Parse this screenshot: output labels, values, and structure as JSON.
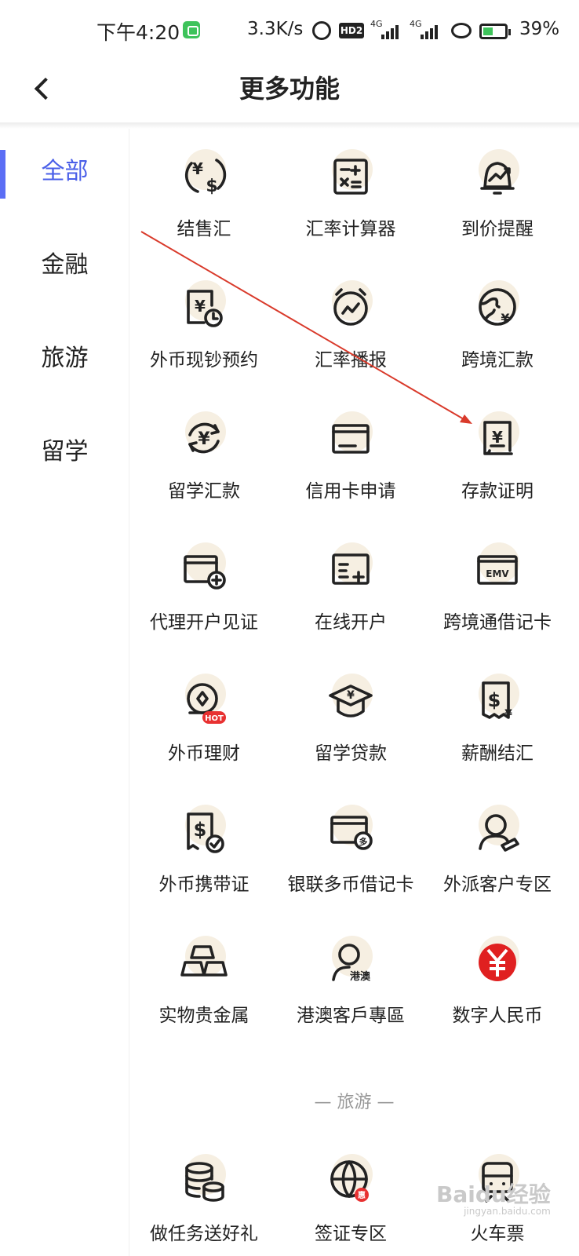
{
  "status_bar": {
    "time": "下午4:20",
    "speed": "3.3K/s",
    "hd": "HD2",
    "signal_1": "4G",
    "signal_2": "4G",
    "battery": "39%"
  },
  "header": {
    "title": "更多功能"
  },
  "sidebar": {
    "items": [
      {
        "label": "全部",
        "active": true
      },
      {
        "label": "金融"
      },
      {
        "label": "旅游"
      },
      {
        "label": "留学"
      }
    ]
  },
  "grid": {
    "items": [
      {
        "label": "结售汇",
        "icon": "exchange-yen-dollar-icon"
      },
      {
        "label": "汇率计算器",
        "icon": "calculator-icon"
      },
      {
        "label": "到价提醒",
        "icon": "bell-trend-icon"
      },
      {
        "label": "外币现钞预约",
        "icon": "cash-clock-icon"
      },
      {
        "label": "汇率播报",
        "icon": "alarm-clock-icon"
      },
      {
        "label": "跨境汇款",
        "icon": "globe-yen-icon"
      },
      {
        "label": "留学汇款",
        "icon": "yen-cycle-icon"
      },
      {
        "label": "信用卡申请",
        "icon": "credit-card-icon"
      },
      {
        "label": "存款证明",
        "icon": "deposit-certificate-icon"
      },
      {
        "label": "代理开户见证",
        "icon": "card-plus-icon"
      },
      {
        "label": "在线开户",
        "icon": "online-account-icon"
      },
      {
        "label": "跨境通借记卡",
        "icon": "emv-card-icon"
      },
      {
        "label": "外币理财",
        "icon": "coin-hot-icon",
        "badge": "HOT"
      },
      {
        "label": "留学贷款",
        "icon": "graduation-cap-yen-icon"
      },
      {
        "label": "薪酬结汇",
        "icon": "dollar-receipt-icon"
      },
      {
        "label": "外币携带证",
        "icon": "dollar-receipt-check-icon"
      },
      {
        "label": "银联多币借记卡",
        "icon": "multi-currency-card-icon",
        "badge": "多"
      },
      {
        "label": "外派客户专区",
        "icon": "person-expat-icon"
      },
      {
        "label": "实物贵金属",
        "icon": "gold-bars-icon"
      },
      {
        "label": "港澳客戶專區",
        "icon": "person-hk-macau-icon",
        "badge": "港澳"
      },
      {
        "label": "数字人民币",
        "icon": "digital-rmb-icon"
      }
    ]
  },
  "section": {
    "title": "— 旅游 —"
  },
  "bottom_row": {
    "items": [
      {
        "label": "做任务送好礼",
        "icon": "database-coins-icon"
      },
      {
        "label": "签证专区",
        "icon": "globe-discount-icon",
        "badge": "惠"
      },
      {
        "label": "火车票",
        "icon": "train-icon"
      }
    ]
  },
  "watermark": {
    "text": "Baidu经验",
    "sub": "jingyan.baidu.com"
  },
  "colors": {
    "accent": "#4a5fe8",
    "icon_bg": "#f6efe2",
    "annotation": "#d93a2b",
    "rmb_red": "#e02020"
  }
}
